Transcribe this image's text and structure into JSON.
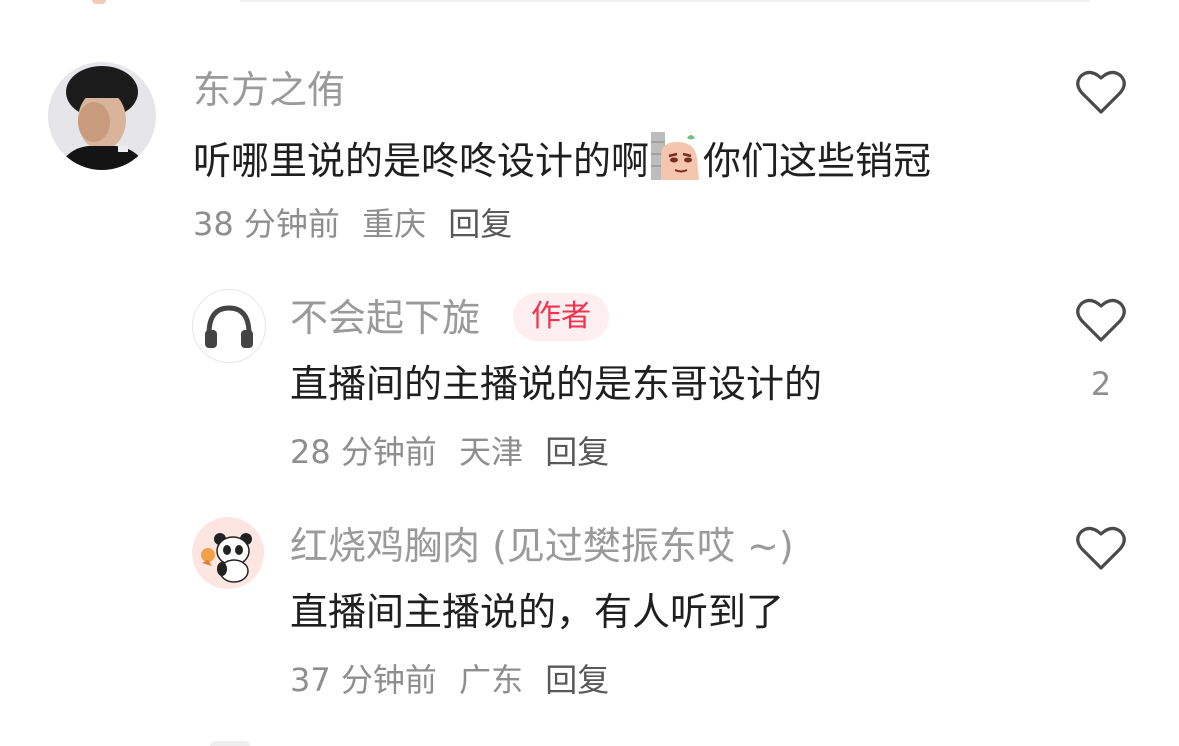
{
  "comments": [
    {
      "username": "东方之侑",
      "text_before": "听哪里说的是咚咚设计的啊",
      "emoji_name": "peeking-potato-emoji",
      "text_after": "你们这些销冠",
      "time": "38 分钟前",
      "location": "重庆",
      "reply_label": "回复"
    },
    {
      "username": "不会起下旋",
      "badge": "作者",
      "text": "直播间的主播说的是东哥设计的",
      "time": "28 分钟前",
      "location": "天津",
      "reply_label": "回复",
      "like_count": "2"
    },
    {
      "username": "红烧鸡胸肉 (见过樊振东哎 ~)",
      "text": "直播间主播说的，有人听到了",
      "time": "37 分钟前",
      "location": "广东",
      "reply_label": "回复"
    }
  ],
  "icons": {
    "like": "heart-outline-icon",
    "avatar2": "headphones-icon",
    "avatar3": "panda-icon"
  },
  "colors": {
    "username": "#9a9a9a",
    "text": "#1f1f1f",
    "meta": "#8e8e8e",
    "badge_bg": "#fdeef0",
    "badge_text": "#f0334f"
  }
}
